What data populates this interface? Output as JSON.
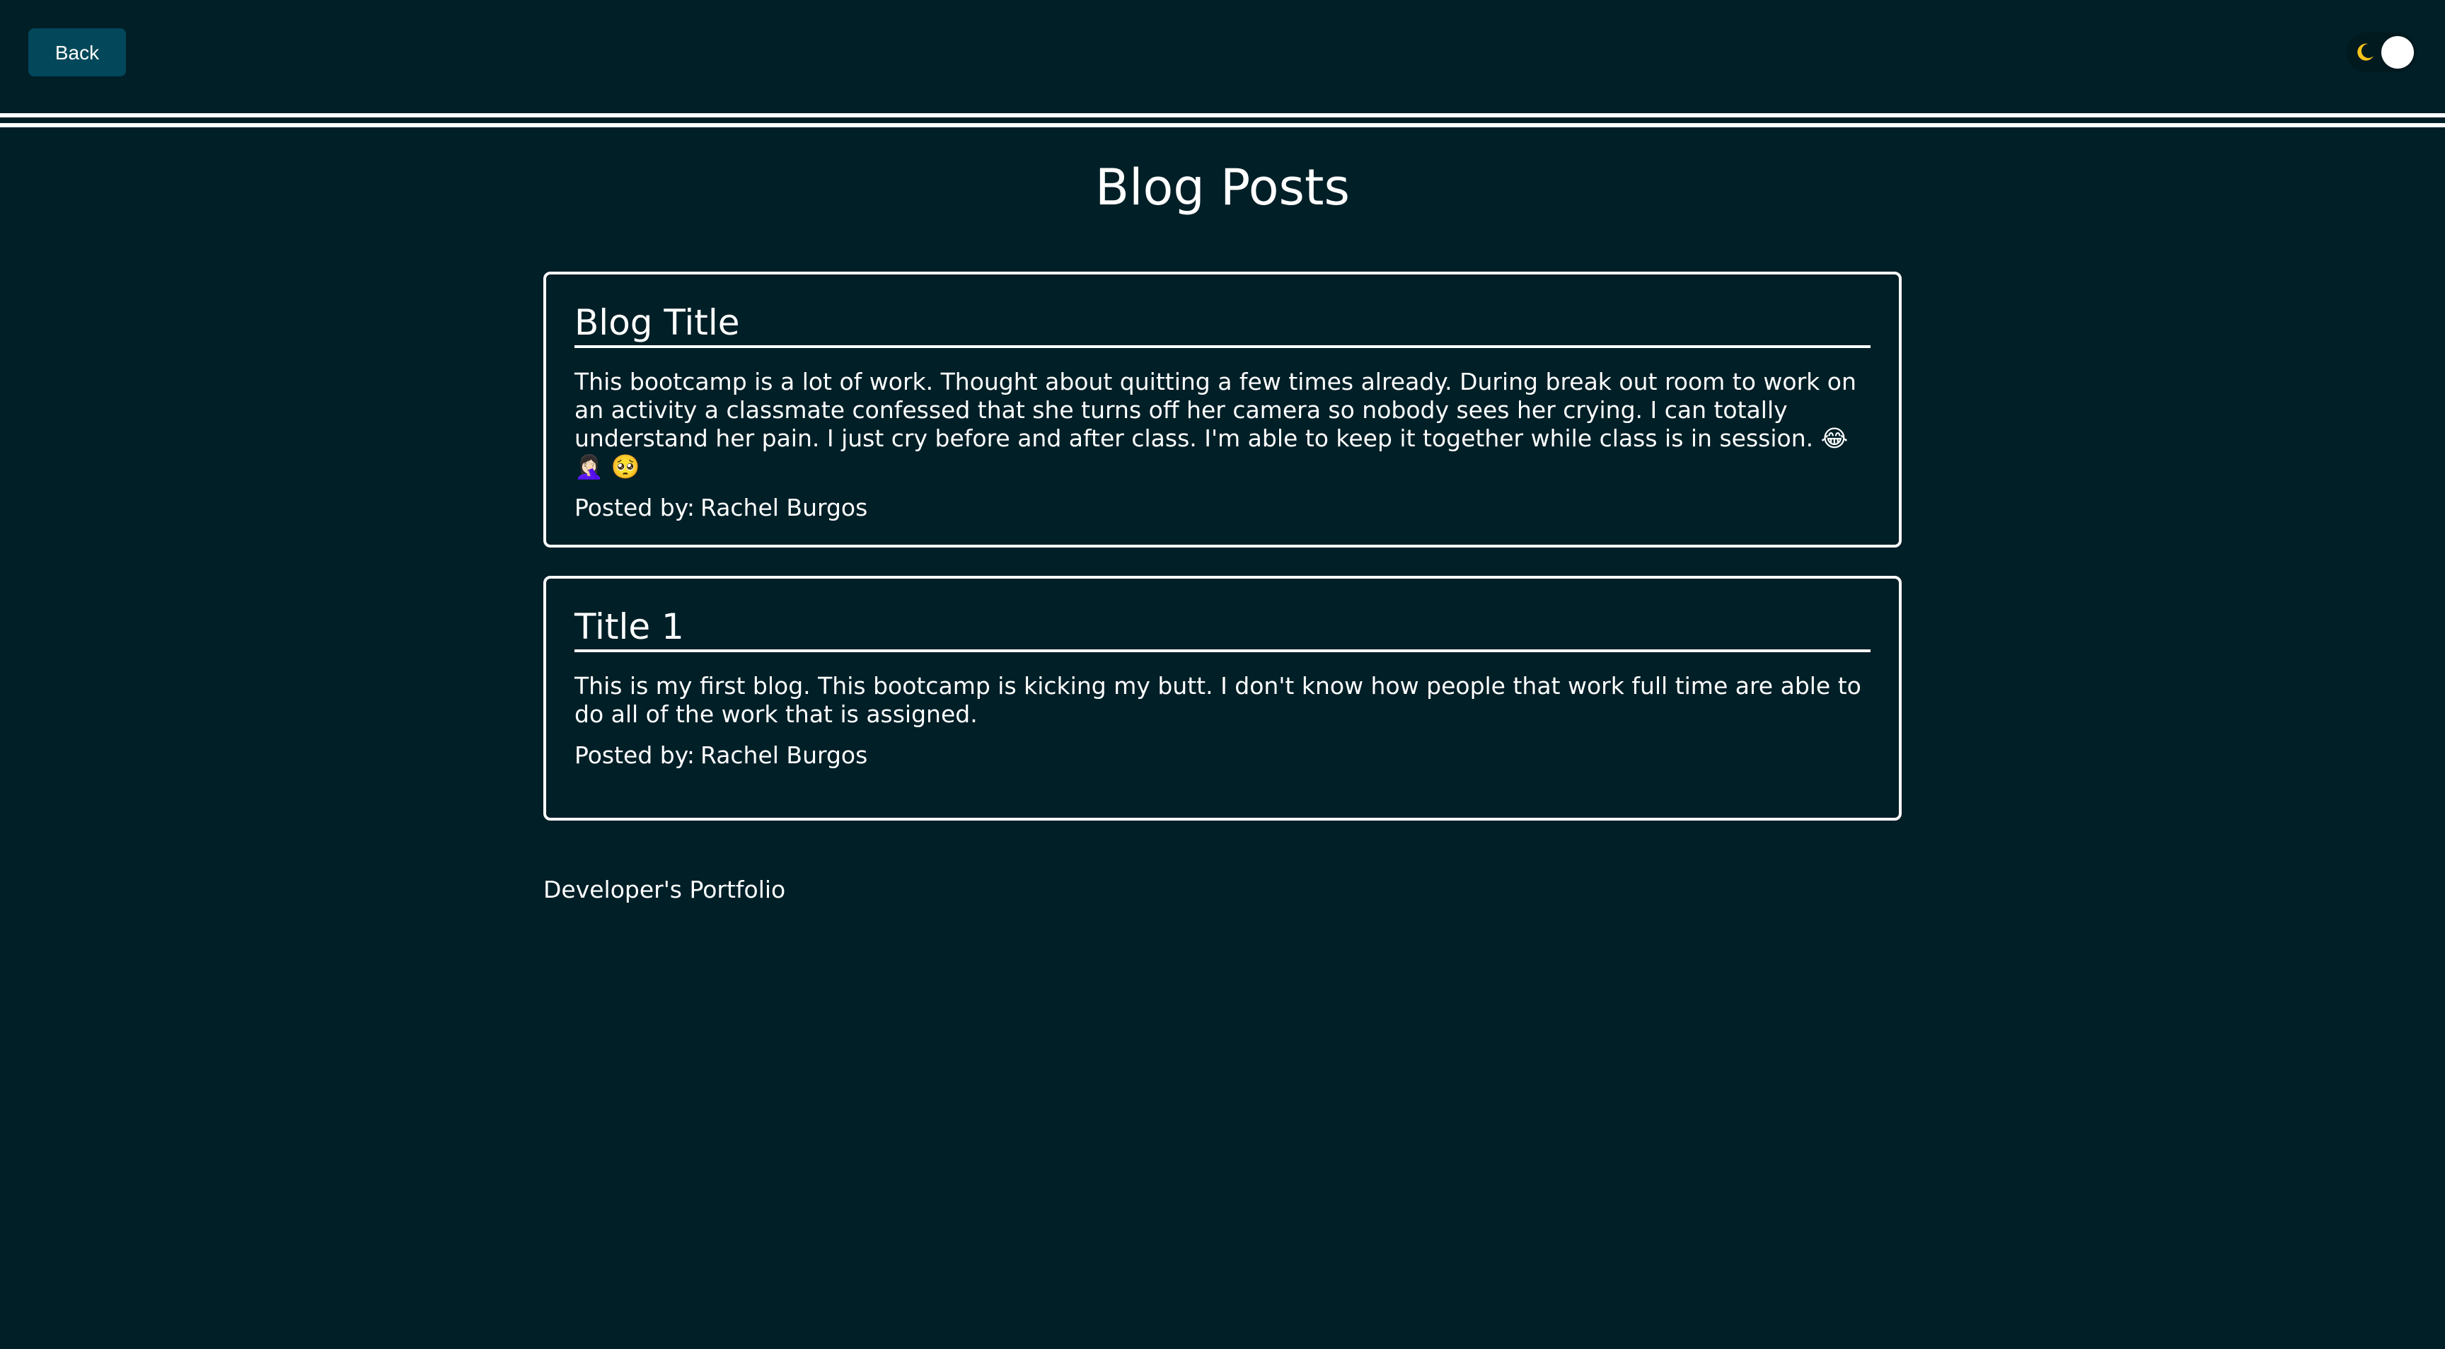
{
  "header": {
    "back_label": "Back",
    "theme_toggle_icon": "moon-icon"
  },
  "main": {
    "title": "Blog Posts",
    "posts": [
      {
        "title": "Blog Title",
        "body": "This bootcamp is a lot of work. Thought about quitting a few times already. During break out room to work on an activity a classmate confessed that she turns off her camera so nobody sees her crying. I can totally understand her pain. I just cry before and after class. I'm able to keep it together while class is in session. 😂 🤦🏻‍♀️ 🥺",
        "author_prefix": "Posted by:",
        "author": "Rachel Burgos"
      },
      {
        "title": "Title 1",
        "body": "This is my first blog. This bootcamp is kicking my butt. I don't know how people that work full time are able to do all of the work that is assigned.",
        "author_prefix": "Posted by:",
        "author": "Rachel Burgos"
      }
    ]
  },
  "footer": {
    "text": "Developer's Portfolio"
  },
  "colors": {
    "background": "#001f27",
    "button": "#03485a",
    "text": "#ffffff",
    "moon": "#f6c21a"
  }
}
